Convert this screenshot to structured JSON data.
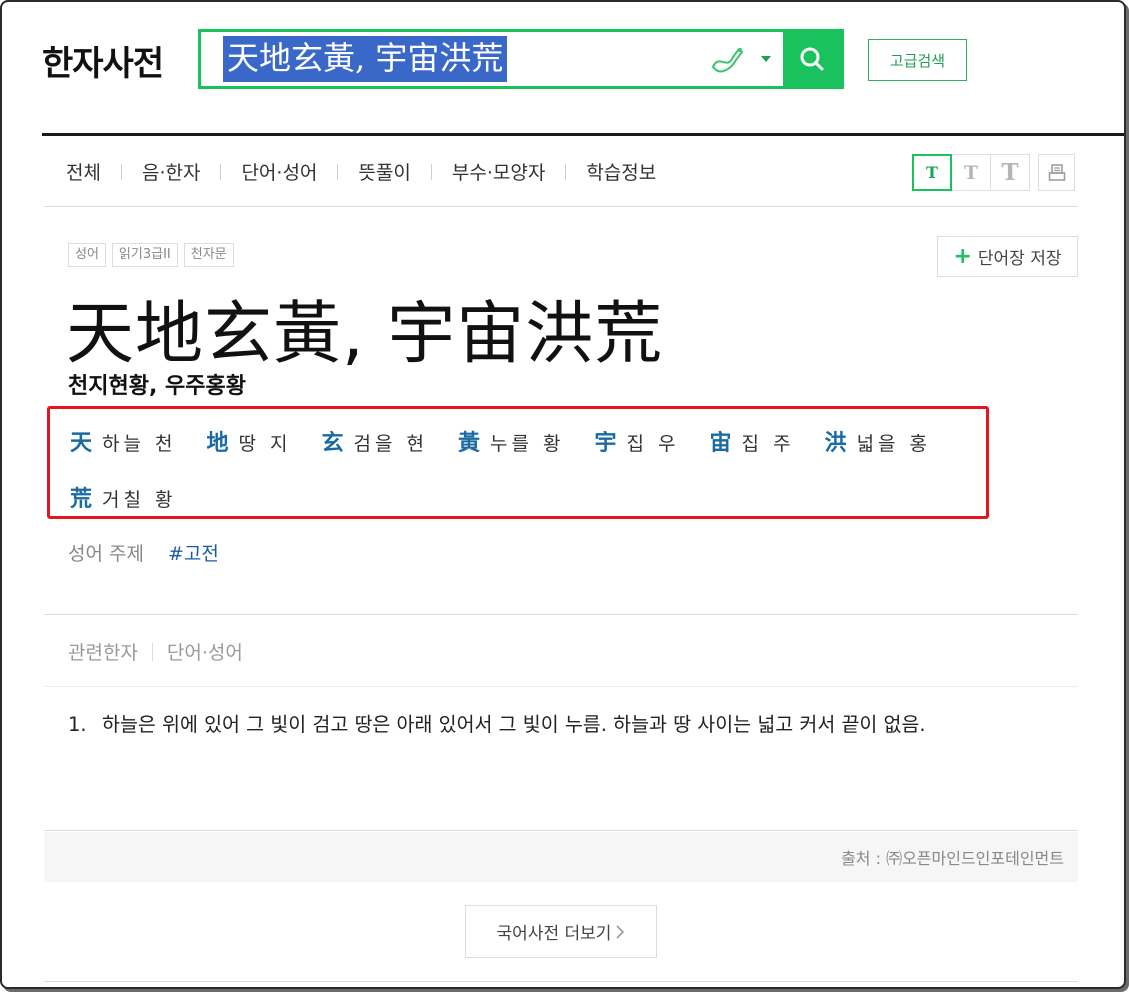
{
  "header": {
    "logo": "한자사전",
    "search_value": "天地玄黃, 宇宙洪荒",
    "advanced_search": "고급검색"
  },
  "tabs": [
    "전체",
    "음·한자",
    "단어·성어",
    "뜻풀이",
    "부수·모양자",
    "학습정보"
  ],
  "font_tools": [
    "T",
    "T",
    "T"
  ],
  "entry": {
    "tags": [
      "성어",
      "읽기3급II",
      "천자문"
    ],
    "save_label": "단어장 저장",
    "headword": "天地玄黃, 宇宙洪荒",
    "reading": "천지현황, 우주홍황",
    "characters": [
      {
        "hanja": "天",
        "hun": "하늘 천"
      },
      {
        "hanja": "地",
        "hun": "땅 지"
      },
      {
        "hanja": "玄",
        "hun": "검을 현"
      },
      {
        "hanja": "黃",
        "hun": "누를 황"
      },
      {
        "hanja": "宇",
        "hun": "집 우"
      },
      {
        "hanja": "宙",
        "hun": "집 주"
      },
      {
        "hanja": "洪",
        "hun": "넓을 홍"
      },
      {
        "hanja": "荒",
        "hun": "거칠 황"
      }
    ],
    "topic_label": "성어 주제",
    "topic_link": "#고전"
  },
  "related": {
    "tabs": [
      "관련한자",
      "단어·성어"
    ]
  },
  "definition": {
    "number": "1.",
    "text": "하늘은 위에 있어 그 빛이 검고 땅은 아래 있어서 그 빛이 누름. 하늘과 땅 사이는 넓고 커서 끝이 없음."
  },
  "source": "출처 : ㈜오픈마인드인포테인먼트",
  "more_button": "국어사전 더보기",
  "colors": {
    "accent_green": "#19c25c",
    "hanja_blue": "#1a6aa3",
    "highlight_red": "#e8141d",
    "selection_blue": "#3968c8"
  }
}
